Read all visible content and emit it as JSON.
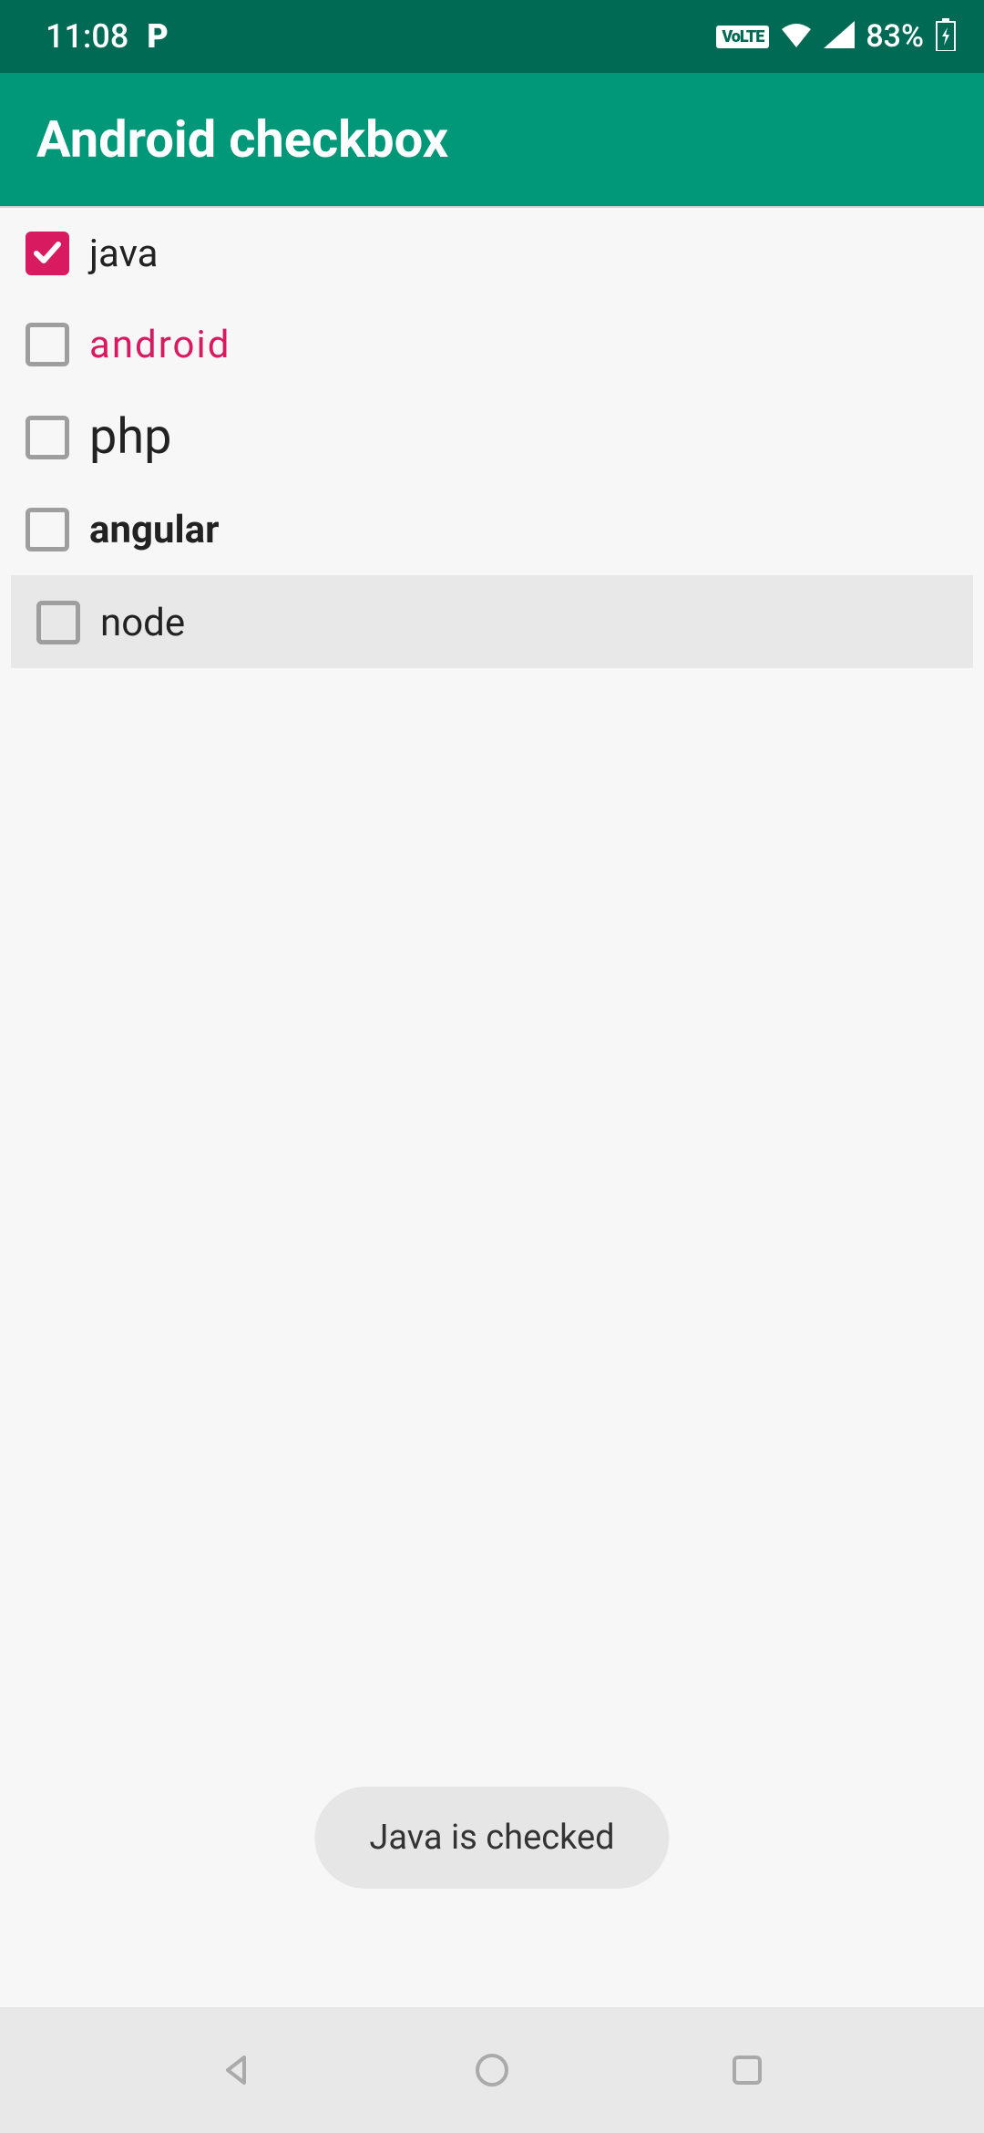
{
  "statusBar": {
    "time": "11:08",
    "pIcon": "P",
    "volte": "VoLTE",
    "battery": "83%"
  },
  "appBar": {
    "title": "Android checkbox"
  },
  "checkboxes": [
    {
      "label": "java",
      "checked": true,
      "styleClass": "label-java",
      "highlighted": false
    },
    {
      "label": "android",
      "checked": false,
      "styleClass": "label-android",
      "highlighted": false
    },
    {
      "label": "php",
      "checked": false,
      "styleClass": "label-php",
      "highlighted": false
    },
    {
      "label": "angular",
      "checked": false,
      "styleClass": "label-angular",
      "highlighted": false
    },
    {
      "label": "node",
      "checked": false,
      "styleClass": "label-node",
      "highlighted": true
    }
  ],
  "toast": {
    "text": "Java is checked"
  }
}
